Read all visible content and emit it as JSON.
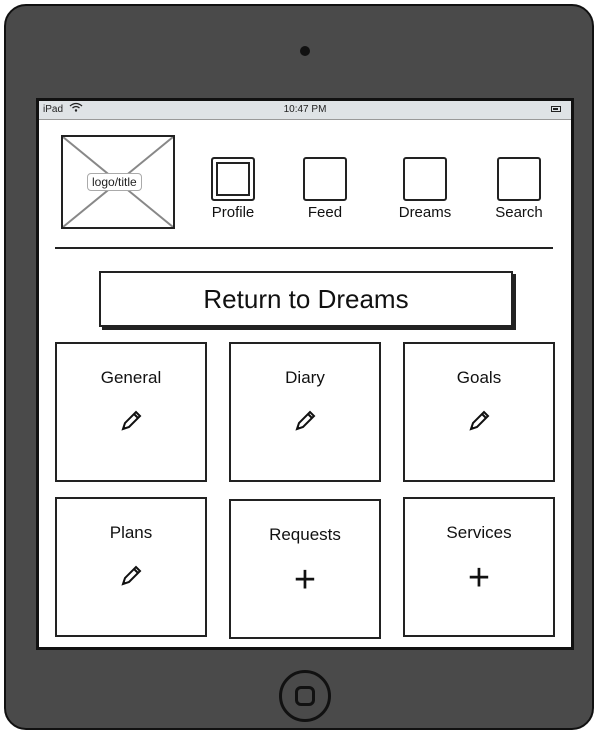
{
  "status_bar": {
    "device": "iPad",
    "time": "10:47 PM"
  },
  "header": {
    "logo_label": "logo/title",
    "nav": [
      {
        "label": "Profile",
        "active": true
      },
      {
        "label": "Feed"
      },
      {
        "label": "Dreams"
      },
      {
        "label": "Search"
      }
    ]
  },
  "main": {
    "return_label": "Return to Dreams",
    "cards": [
      {
        "label": "General",
        "icon": "pencil-icon"
      },
      {
        "label": "Diary",
        "icon": "pencil-icon"
      },
      {
        "label": "Goals",
        "icon": "pencil-icon"
      },
      {
        "label": "Plans",
        "icon": "pencil-icon"
      },
      {
        "label": "Requests",
        "icon": "plus-icon"
      },
      {
        "label": "Services",
        "icon": "plus-icon"
      }
    ]
  },
  "icons": {
    "plus": "+"
  },
  "colors": {
    "device_bezel": "#4a4a4a",
    "statusbar_bg": "#dfe3e6",
    "stroke": "#222222"
  }
}
